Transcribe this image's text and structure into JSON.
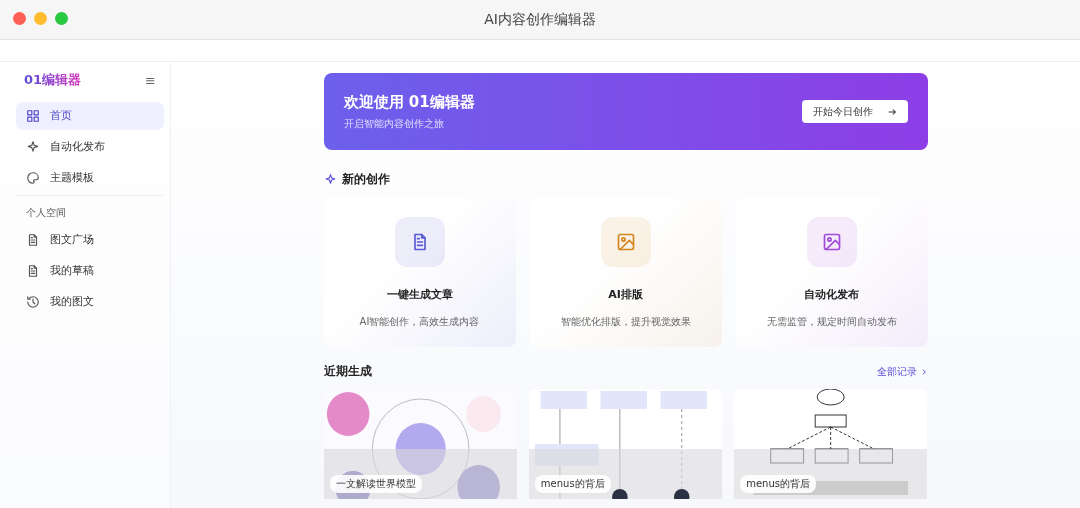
{
  "window": {
    "title": "AI内容创作编辑器"
  },
  "sidebar": {
    "logo": "01编辑器",
    "menu_icon": "≡",
    "items": [
      {
        "label": "首页",
        "selected": true
      },
      {
        "label": "自动化发布",
        "selected": false
      },
      {
        "label": "主题模板",
        "selected": false
      }
    ],
    "section": {
      "title": "个人空间",
      "items": [
        {
          "label": "图文广场",
          "selected": false
        },
        {
          "label": "我的草稿",
          "selected": false
        },
        {
          "label": "我的图文",
          "selected": false
        }
      ]
    }
  },
  "banner": {
    "title": "欢迎使用 01编辑器",
    "subtitle": "开启智能内容创作之旅",
    "button": "开始今日创作"
  },
  "create": {
    "title": "新的创作",
    "cards": [
      {
        "title": "一键生成文章",
        "desc": "AI智能创作，高效生成内容",
        "color": "#5b5bd6"
      },
      {
        "title": "AI排版",
        "desc": "智能优化排版，提升视觉效果",
        "color": "#d4861c"
      },
      {
        "title": "自动化发布",
        "desc": "无需监管，规定时间自动发布",
        "color": "#a24ad8"
      }
    ]
  },
  "recent": {
    "title": "近期生成",
    "link": "全部记录",
    "items": [
      {
        "caption": "一文解读世界模型",
        "kind": "picture"
      },
      {
        "caption": "menus的背后",
        "kind": "picture"
      },
      {
        "caption": "menus的背后",
        "kind": "picture"
      }
    ]
  }
}
